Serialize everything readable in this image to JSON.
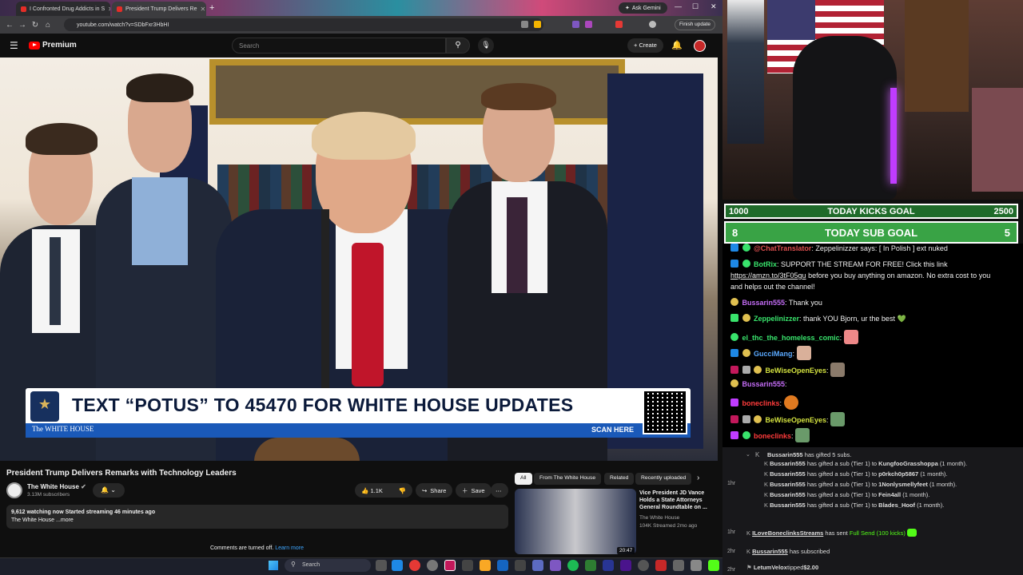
{
  "browser": {
    "tabs": [
      {
        "title": "I Confronted Drug Addicts in S"
      },
      {
        "title": "President Trump Delivers Re"
      }
    ],
    "ask_gemini": "Ask Gemini",
    "url": "youtube.com/watch?v=SDbFxr3HbHI",
    "finish_update": "Finish update"
  },
  "youtube": {
    "logo": "Premium",
    "search_placeholder": "Search",
    "create": "Create",
    "video": {
      "banner_text": "TEXT “POTUS” TO 45470 FOR WHITE HOUSE UPDATES",
      "banner_brand": "The WHITE HOUSE",
      "scan_here": "SCAN HERE"
    },
    "title": "President Trump Delivers Remarks with Technology Leaders",
    "channel": "The White House",
    "subscribers": "3.13M subscribers",
    "likes": "1.1K",
    "share": "Share",
    "save": "Save",
    "desc_line1": "9,612 watching now  Started streaming 46 minutes ago",
    "desc_line2": "The White House ...more",
    "comments_off": "Comments are turned off.",
    "learn_more": "Learn more",
    "chips": [
      "All",
      "From The White House",
      "Related",
      "Recently uploaded"
    ],
    "related": {
      "title": "Vice President JD Vance Holds a State Attorneys General Roundtable on ...",
      "channel": "The White House",
      "meta": "104K  Streamed 2mo ago",
      "duration": "20:47"
    }
  },
  "taskbar": {
    "search": "Search"
  },
  "stream": {
    "goal1": {
      "left": "1000",
      "label": "TODAY KICKS GOAL",
      "right": "2500"
    },
    "goal2": {
      "left": "8",
      "label": "TODAY SUB GOAL",
      "right": "5"
    },
    "chat": [
      {
        "user": "@ChatTranslator",
        "text": ": Zeppelinizzer says: [ In Polish ] ext nuked",
        "color": "#e05050"
      },
      {
        "user": "BotRix",
        "text": ": SUPPORT THE STREAM FOR FREE! Click this link",
        "color": "#39e36c"
      },
      {
        "link": "https://amzn.to/3tF05gu",
        "text": " before you buy anything on amazon. No extra cost to you"
      },
      {
        "text": "and helps out the channel!"
      },
      {
        "user": "Bussarin555",
        "text": ": Thank you",
        "color": "#c36cf5"
      },
      {
        "user": "Zeppelinizzer",
        "text": ": thank YOU Bjorn, ur the best 💚",
        "color": "#39e36c"
      },
      {
        "user": "el_thc_the_homeless_comic",
        "text": ":",
        "color": "#39e36c"
      },
      {
        "user": "GucciMang",
        "text": ":",
        "color": "#5aa9ff"
      },
      {
        "user": "BeWiseOpenEyes",
        "text": ":",
        "color": "#d4e340"
      },
      {
        "user": "Bussarin555",
        "text": ":",
        "color": "#c36cf5"
      },
      {
        "user": "boneclinks",
        "text": ":",
        "color": "#ff3b3b"
      },
      {
        "user": "BeWiseOpenEyes",
        "text": ":",
        "color": "#d4e340"
      },
      {
        "user": "boneclinks",
        "text": ":",
        "color": "#ff3b3b"
      }
    ],
    "events": {
      "gift_header": {
        "user": "Bussarin555",
        "text": "has gifted 5 subs."
      },
      "gifts": [
        {
          "user": "Bussarin555",
          "mid": "has gifted a sub (Tier 1) to",
          "to": "KungfooGrasshoppa",
          "tail": "(1 month)."
        },
        {
          "user": "Bussarin555",
          "mid": "has gifted a sub (Tier 1) to",
          "to": "p0rkch0p5867",
          "tail": "(1 month)."
        },
        {
          "user": "Bussarin555",
          "mid": "has gifted a sub (Tier 1) to",
          "to": "1Nonlysmellyfeet",
          "tail": "(1 month)."
        },
        {
          "user": "Bussarin555",
          "mid": "has gifted a sub (Tier 1) to",
          "to": "Fein4all",
          "tail": "(1 month)."
        },
        {
          "user": "Bussarin555",
          "mid": "has gifted a sub (Tier 1) to",
          "to": "Blades_Hoof",
          "tail": "(1 month)."
        }
      ],
      "t1": "1hr",
      "t2": "1hr",
      "send": {
        "user": "ILoveBoneclinksStreams",
        "mid": "has sent",
        "item": "Full Send (100 kicks)"
      },
      "t3": "2hr",
      "sub": {
        "user": "Bussarin555",
        "text": "has subscribed"
      },
      "t4": "2hr",
      "tip": {
        "user": "LetumVelox",
        "mid": "tipped",
        "amount": "$2.00"
      }
    }
  }
}
